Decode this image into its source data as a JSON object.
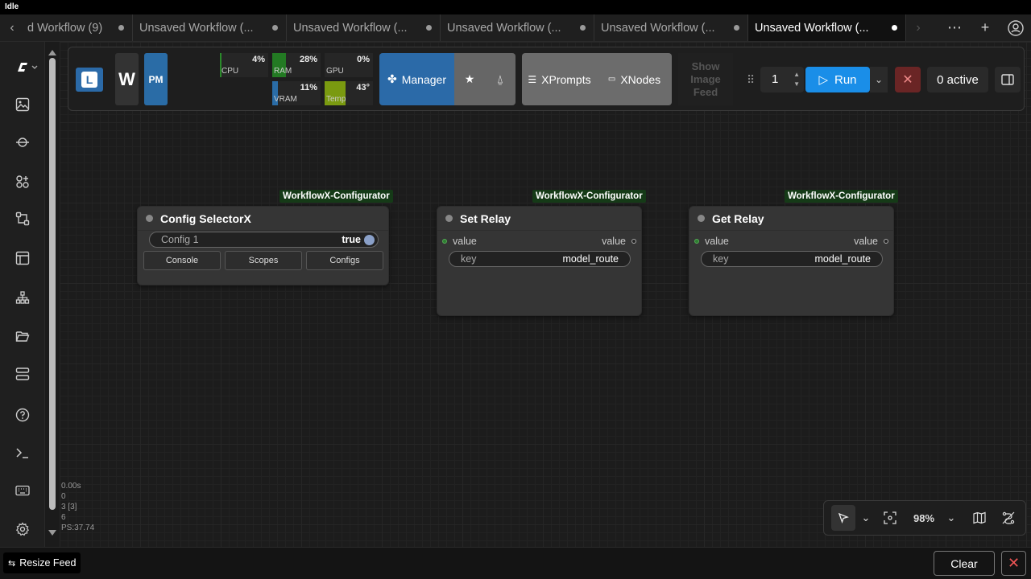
{
  "window": {
    "title": "Idle"
  },
  "tabs": [
    {
      "label": "d Workflow (9)",
      "active": false
    },
    {
      "label": "Unsaved Workflow (...",
      "active": false
    },
    {
      "label": "Unsaved Workflow (...",
      "active": false
    },
    {
      "label": "Unsaved Workflow (...",
      "active": false
    },
    {
      "label": "Unsaved Workflow (...",
      "active": false
    },
    {
      "label": "Unsaved Workflow (...",
      "active": true
    }
  ],
  "toolbar": {
    "logo_w": "W",
    "logo_pm": "PM",
    "meters": {
      "cpu": {
        "label": "CPU",
        "value": "4%"
      },
      "ram": {
        "label": "RAM",
        "value": "28%"
      },
      "gpu": {
        "label": "GPU",
        "value": "0%"
      },
      "vram": {
        "label": "VRAM",
        "value": "11%"
      },
      "temp": {
        "label": "Temp",
        "value": "43°"
      }
    },
    "manager_label": "Manager",
    "xprompts_label": "XPrompts",
    "xnodes_label": "XNodes",
    "show_feed_label": "Show Image Feed",
    "batch_count": "1",
    "run_label": "Run",
    "active_label": "0 active"
  },
  "nodes": [
    {
      "badge": "WorkflowX-Configurator",
      "title": "Config SelectorX",
      "widget": {
        "label": "Config 1",
        "value": "true"
      },
      "buttons": [
        "Console",
        "Scopes",
        "Configs"
      ]
    },
    {
      "badge": "WorkflowX-Configurator",
      "title": "Set Relay",
      "input": "value",
      "output": "value",
      "widget": {
        "label": "key",
        "value": "model_route"
      }
    },
    {
      "badge": "WorkflowX-Configurator",
      "title": "Get Relay",
      "input": "value",
      "output": "value",
      "widget": {
        "label": "key",
        "value": "model_route"
      }
    }
  ],
  "stats": {
    "line1": "0.00s",
    "line2": "0",
    "line3": "3 [3]",
    "line4": "6",
    "line5": "PS:37.74"
  },
  "zoom": {
    "level": "98%"
  },
  "footer": {
    "resize_feed_label": "Resize Feed",
    "clear_label": "Clear"
  },
  "colors": {
    "accent": "#1a8ee8",
    "manager": "#2b6aa8",
    "badge": "#153a17"
  }
}
